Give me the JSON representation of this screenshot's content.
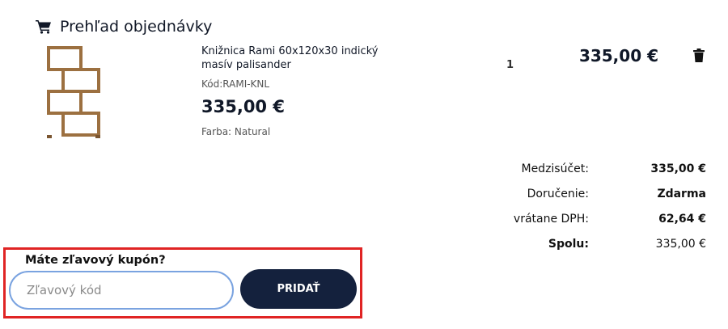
{
  "header": {
    "title": "Prehľad objednávky",
    "icon": "cart-icon"
  },
  "product": {
    "name": "Knižnica Rami 60x120x30 indický masív palisander",
    "code": "Kód:RAMI-KNL",
    "price": "335,00 €",
    "color": "Farba: Natural",
    "quantity": "1",
    "line_total": "335,00 €",
    "delete_icon": "trash-icon"
  },
  "summary": {
    "rows": [
      {
        "label": "Medzisúčet:",
        "value": "335,00 €"
      },
      {
        "label": "Doručenie:",
        "value": "Zdarma"
      },
      {
        "label": "vrátane DPH:",
        "value": "62,64 €"
      },
      {
        "label": "Spolu:",
        "value": "335,00 €"
      }
    ]
  },
  "coupon": {
    "title": "Máte zľavový kupón?",
    "placeholder": "Zľavový kód",
    "value": "",
    "button_label": "PRIDAŤ",
    "highlight_color": "#e02424",
    "button_color": "#14213d"
  }
}
